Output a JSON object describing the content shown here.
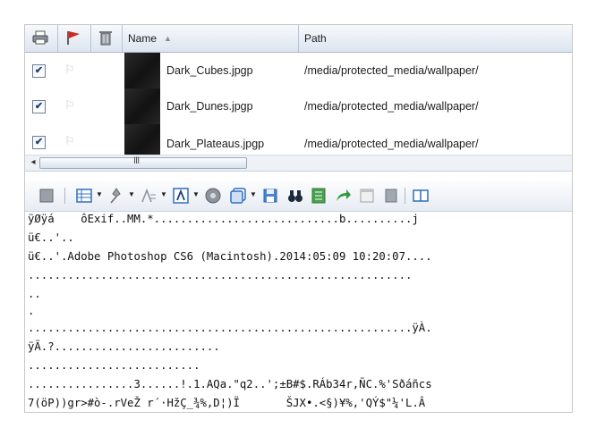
{
  "header": {
    "name_label": "Name",
    "sort_arrow": "▲",
    "path_label": "Path"
  },
  "files": [
    {
      "checked": "✔",
      "name": "Dark_Cubes.jpgp",
      "path": "/media/protected_media/wallpaper/"
    },
    {
      "checked": "✔",
      "name": "Dark_Dunes.jpgp",
      "path": "/media/protected_media/wallpaper/"
    },
    {
      "checked": "✔",
      "name": "Dark_Plateaus.jpgp",
      "path": "/media/protected_media/wallpaper/"
    }
  ],
  "scrollbar": {
    "left_arrow": "◂",
    "grip": "III"
  },
  "dump": {
    "lines": [
      "ÿØÿá    ôExif..MM.*............................b..........j",
      "ü€..'..",
      "ü€..'.Adobe Photoshop CS6 (Macintosh).2014:05:09 10:20:07....",
      "..........................................................",
      "..",
      ".",
      "..........................................................ÿÀ.",
      "ÿÄ.?.........................",
      "..........................",
      "................3......!.1.AQa.\"q2..';±B#$.RÁb34r,ÑC.%'Sðáñcs",
      "7(öP))gr>#ò-.rVeŽ r´·HžÇ_¾%,D¦)Ï       ŠJX•.<§)¥%,'QÝ$\"¼'L.Â"
    ]
  },
  "colors": {
    "header_bg": "#dde5f0",
    "toolbar_bg": "#e7ecf3",
    "accent_blue": "#2e6fc0",
    "flag_red": "#d8261c",
    "green": "#2f9a3a"
  }
}
